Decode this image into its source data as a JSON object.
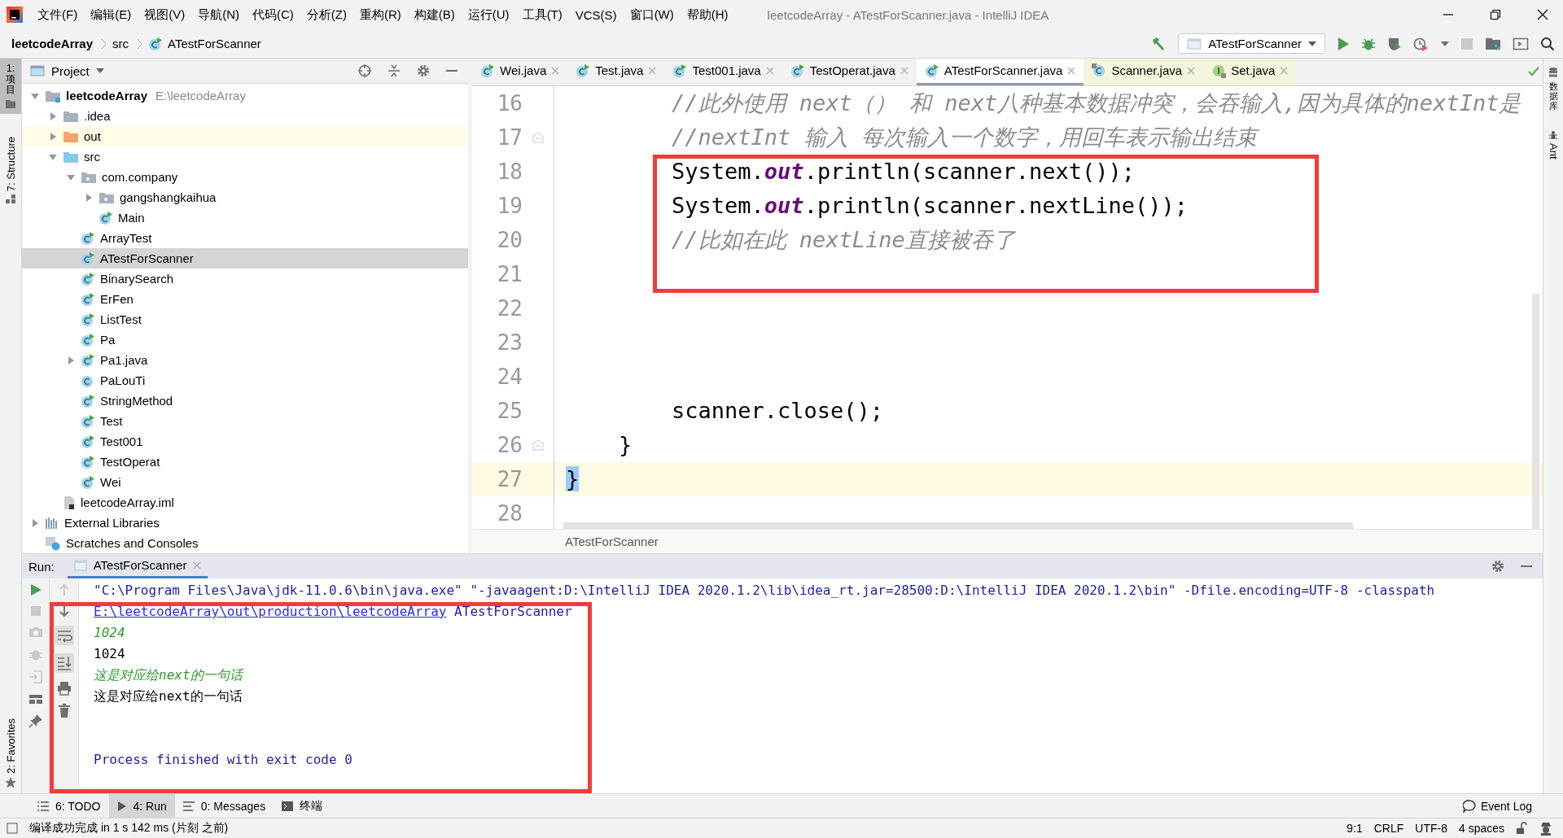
{
  "window": {
    "title": "leetcodeArray - ATestForScanner.java - IntelliJ IDEA",
    "menu": [
      "文件(F)",
      "编辑(E)",
      "视图(V)",
      "导航(N)",
      "代码(C)",
      "分析(Z)",
      "重构(R)",
      "构建(B)",
      "运行(U)",
      "工具(T)",
      "VCS(S)",
      "窗口(W)",
      "帮助(H)"
    ]
  },
  "navigation": {
    "breadcrumb": [
      {
        "label": "leetcodeArray",
        "kind": "project"
      },
      {
        "label": "src",
        "kind": "folder"
      },
      {
        "label": "ATestForScanner",
        "kind": "class"
      }
    ],
    "run_configuration": "ATestForScanner"
  },
  "left_stripe": [
    {
      "label": "1: 项目",
      "selected": true
    },
    {
      "label": "7: Structure",
      "selected": false
    }
  ],
  "favorites_stripe": "2: Favorites",
  "right_stripe": [
    "数据库",
    "Ant"
  ],
  "project_panel": {
    "title": "Project",
    "tree": [
      {
        "label": "leetcodeArray",
        "kind": "module",
        "hint": "E:\\leetcodeArray",
        "expanded": true,
        "selected": false,
        "highlighted": false,
        "children": [
          {
            "label": ".idea",
            "kind": "folder",
            "expanded": false,
            "selected": false,
            "highlighted": false
          },
          {
            "label": "out",
            "kind": "excluded",
            "expanded": false,
            "selected": false,
            "highlighted": true
          },
          {
            "label": "src",
            "kind": "source",
            "expanded": true,
            "selected": false,
            "highlighted": false,
            "children": [
              {
                "label": "com.company",
                "kind": "package",
                "expanded": true,
                "selected": false,
                "highlighted": false,
                "children": [
                  {
                    "label": "gangshangkaihua",
                    "kind": "package",
                    "expanded": false,
                    "selected": false,
                    "highlighted": false
                  },
                  {
                    "label": "Main",
                    "kind": "class",
                    "runnable": true,
                    "selected": false,
                    "highlighted": false
                  }
                ]
              },
              {
                "label": "ArrayTest",
                "kind": "class",
                "runnable": true,
                "selected": false,
                "highlighted": false
              },
              {
                "label": "ATestForScanner",
                "kind": "class",
                "runnable": true,
                "selected": true,
                "highlighted": false
              },
              {
                "label": "BinarySearch",
                "kind": "class",
                "runnable": true,
                "selected": false,
                "highlighted": false
              },
              {
                "label": "ErFen",
                "kind": "class",
                "runnable": true,
                "selected": false,
                "highlighted": false
              },
              {
                "label": "ListTest",
                "kind": "class",
                "runnable": true,
                "selected": false,
                "highlighted": false
              },
              {
                "label": "Pa",
                "kind": "class",
                "runnable": true,
                "selected": false,
                "highlighted": false
              },
              {
                "label": "Pa1.java",
                "kind": "class",
                "runnable": true,
                "expanded": false,
                "selected": false,
                "highlighted": false
              },
              {
                "label": "PaLouTi",
                "kind": "class",
                "runnable": false,
                "selected": false,
                "highlighted": false
              },
              {
                "label": "StringMethod",
                "kind": "class",
                "runnable": true,
                "selected": false,
                "highlighted": false
              },
              {
                "label": "Test",
                "kind": "class",
                "runnable": true,
                "selected": false,
                "highlighted": false
              },
              {
                "label": "Test001",
                "kind": "class",
                "runnable": true,
                "selected": false,
                "highlighted": false
              },
              {
                "label": "TestOperat",
                "kind": "class",
                "runnable": true,
                "selected": false,
                "highlighted": false
              },
              {
                "label": "Wei",
                "kind": "class",
                "runnable": true,
                "selected": false,
                "highlighted": false
              }
            ]
          },
          {
            "label": "leetcodeArray.iml",
            "kind": "iml",
            "selected": false,
            "highlighted": false
          }
        ]
      },
      {
        "label": "External Libraries",
        "kind": "libraries",
        "expanded": false,
        "selected": false,
        "highlighted": false
      },
      {
        "label": "Scratches and Consoles",
        "kind": "scratches",
        "selected": false,
        "highlighted": false
      }
    ]
  },
  "editor": {
    "tabs": [
      {
        "label": "Wei.java",
        "kind": "class",
        "external": false,
        "selected": false
      },
      {
        "label": "Test.java",
        "kind": "class",
        "external": false,
        "selected": false
      },
      {
        "label": "Test001.java",
        "kind": "class",
        "external": false,
        "selected": false
      },
      {
        "label": "TestOperat.java",
        "kind": "class",
        "external": false,
        "selected": false
      },
      {
        "label": "ATestForScanner.java",
        "kind": "class",
        "external": false,
        "selected": true
      },
      {
        "label": "Scanner.java",
        "kind": "library",
        "external": true,
        "selected": false
      },
      {
        "label": "Set.java",
        "kind": "interface",
        "external": true,
        "selected": false
      }
    ],
    "lines": [
      {
        "number": "16",
        "fold": false,
        "current": false,
        "segments": [
          {
            "text": "        //此外使用 next（） 和 next八种基本数据冲突，会吞输入,因为具体的nextInt是",
            "kind": "comment"
          }
        ]
      },
      {
        "number": "17",
        "fold": true,
        "current": false,
        "segments": [
          {
            "text": "        //nextInt 输入 每次输入一个数字，用回车表示输出结束",
            "kind": "comment"
          }
        ]
      },
      {
        "number": "18",
        "fold": false,
        "current": false,
        "segments": [
          {
            "text": "        System.",
            "kind": "plain"
          },
          {
            "text": "out",
            "kind": "field"
          },
          {
            "text": ".println(scanner.next());",
            "kind": "plain"
          }
        ]
      },
      {
        "number": "19",
        "fold": false,
        "current": false,
        "segments": [
          {
            "text": "        System.",
            "kind": "plain"
          },
          {
            "text": "out",
            "kind": "field"
          },
          {
            "text": ".println(scanner.nextLine());",
            "kind": "plain"
          }
        ]
      },
      {
        "number": "20",
        "fold": false,
        "current": false,
        "segments": [
          {
            "text": "        //比如在此 nextLine直接被吞了",
            "kind": "comment"
          }
        ]
      },
      {
        "number": "21",
        "fold": false,
        "current": false
      },
      {
        "number": "22",
        "fold": false,
        "current": false
      },
      {
        "number": "23",
        "fold": false,
        "current": false
      },
      {
        "number": "24",
        "fold": false,
        "current": false
      },
      {
        "number": "25",
        "fold": false,
        "current": false,
        "segments": [
          {
            "text": "        scanner.close();",
            "kind": "plain"
          }
        ]
      },
      {
        "number": "26",
        "fold": true,
        "current": false,
        "segments": [
          {
            "text": "    }",
            "kind": "plain"
          }
        ]
      },
      {
        "number": "27",
        "fold": false,
        "current": true,
        "segments": [
          {
            "text": "}",
            "kind": "brace_match"
          }
        ]
      },
      {
        "number": "28",
        "fold": false,
        "current": false
      }
    ],
    "breadcrumb": "ATestForScanner"
  },
  "run_panel": {
    "label": "Run:",
    "tab": "ATestForScanner",
    "console": [
      {
        "kind": "command",
        "text": "\"C:\\Program Files\\Java\\jdk-11.0.6\\bin\\java.exe\" \"-javaagent:D:\\IntelliJ IDEA 2020.1.2\\lib\\idea_rt.jar=28500:D:\\IntelliJ IDEA 2020.1.2\\bin\" -Dfile.encoding=UTF-8 -classpath"
      },
      {
        "kind": "path",
        "link": "E:\\leetcodeArray\\out\\production\\leetcodeArray",
        "text": " ATestForScanner"
      },
      {
        "kind": "input",
        "text": "1024"
      },
      {
        "kind": "output",
        "text": "1024"
      },
      {
        "kind": "input",
        "text": "这是对应给next的一句话"
      },
      {
        "kind": "output",
        "text": "这是对应给next的一句话"
      },
      {
        "kind": "exit",
        "text": "Process finished with exit code 0"
      }
    ]
  },
  "bottom_tools": [
    {
      "label": "6: TODO",
      "selected": false
    },
    {
      "label": "4: Run",
      "selected": true
    },
    {
      "label": "0: Messages",
      "selected": false
    },
    {
      "label": "终端",
      "selected": false
    }
  ],
  "event_log": "Event Log",
  "status_bar": {
    "message": "编译成功完成 in 1 s 142 ms (片刻 之前)",
    "items": [
      "9:1",
      "CRLF",
      "UTF-8",
      "4 spaces"
    ]
  }
}
